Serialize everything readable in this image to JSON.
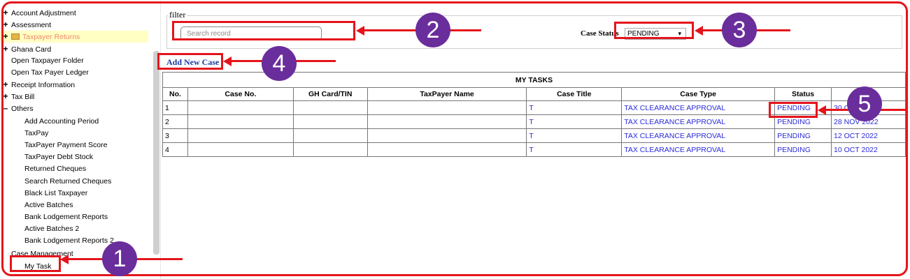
{
  "sidebar": {
    "items": [
      {
        "sign": "+",
        "label": "Account Adjustment"
      },
      {
        "sign": "+",
        "label": "Assessment"
      },
      {
        "sign": "+",
        "label": "Taxpayer Returns"
      },
      {
        "sign": "+",
        "label": "Ghana Card"
      },
      {
        "sign": "",
        "label": "Open Taxpayer Folder"
      },
      {
        "sign": "",
        "label": "Open Tax Payer Ledger"
      },
      {
        "sign": "+",
        "label": "Receipt Information"
      },
      {
        "sign": "+",
        "label": "Tax Bill"
      },
      {
        "sign": "–",
        "label": "Others"
      }
    ],
    "sub_items": [
      "Add Accounting Period",
      "TaxPay",
      "TaxPayer Payment Score",
      "TaxPayer Debt Stock",
      "Returned Cheques",
      "Search Returned Cheques",
      "Black List Taxpayer",
      "Active Batches",
      "Bank Lodgement Reports",
      "Active Batches 2",
      "Bank Lodgement Reports 2"
    ],
    "case_management": "Case Management",
    "my_task": "My Task"
  },
  "filter": {
    "legend": "filter",
    "search_placeholder": "Search record",
    "status_label": "Case Status",
    "status_value": "PENDING",
    "status_arrow": "▾"
  },
  "add_new_case": "Add New Case",
  "table": {
    "caption": "MY TASKS",
    "headers": [
      "No.",
      "Case No.",
      "GH Card/TIN",
      "TaxPayer Name",
      "Case Title",
      "Case Type",
      "Status",
      ""
    ],
    "rows": [
      {
        "no": "1",
        "case_no": "",
        "tin": "",
        "name": "",
        "title": "T",
        "type": "TAX CLEARANCE APPROVAL",
        "status": "PENDING",
        "date": "30 O"
      },
      {
        "no": "2",
        "case_no": "",
        "tin": "",
        "name": "",
        "title": "T",
        "type": "TAX CLEARANCE APPROVAL",
        "status": "PENDING",
        "date": "28 NOV 2022"
      },
      {
        "no": "3",
        "case_no": "",
        "tin": "",
        "name": "",
        "title": "T",
        "type": "TAX CLEARANCE APPROVAL",
        "status": "PENDING",
        "date": "12 OCT 2022"
      },
      {
        "no": "4",
        "case_no": "",
        "tin": "",
        "name": "",
        "title": "T",
        "type": "TAX CLEARANCE APPROVAL",
        "status": "PENDING",
        "date": "10 OCT 2022"
      }
    ]
  },
  "annotations": {
    "badges": [
      "1",
      "2",
      "3",
      "4",
      "5"
    ],
    "color": "#e5141b",
    "badge_color": "#6a2d9c"
  }
}
